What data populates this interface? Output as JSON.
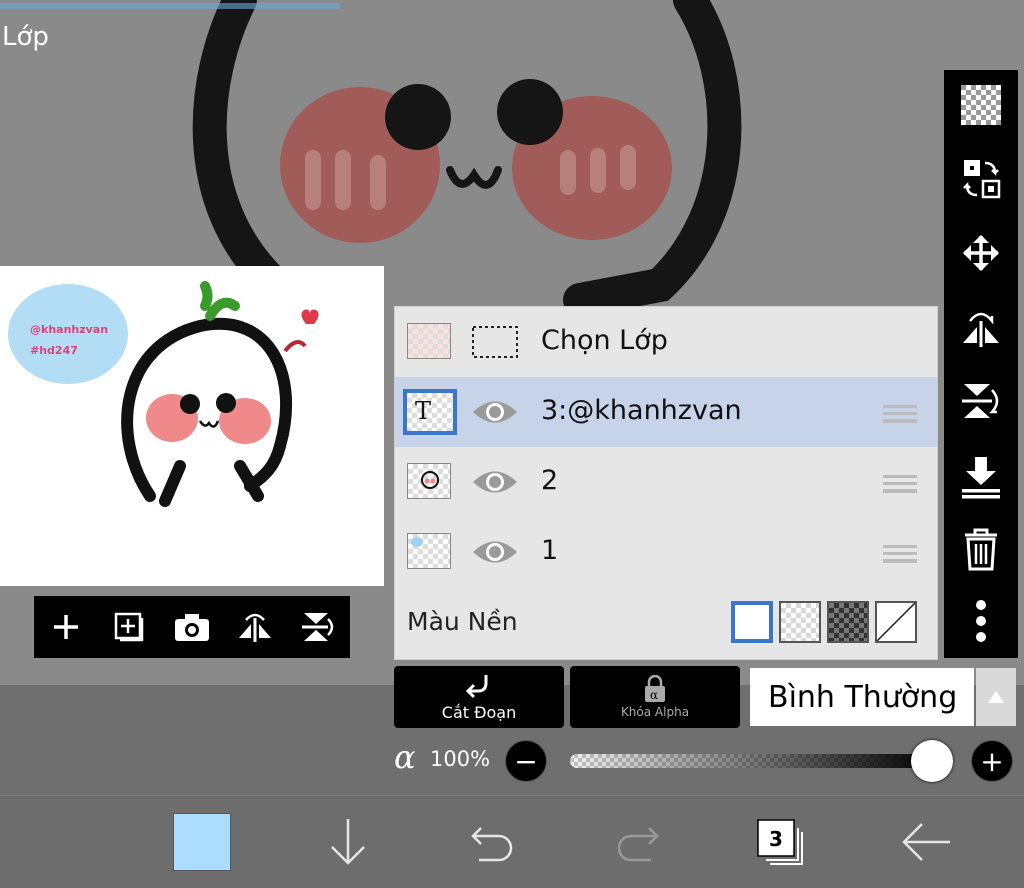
{
  "page": {
    "title": "Lớp"
  },
  "colors": {
    "selected_row": "#c7d3e8",
    "accent_blue": "#3c76c9",
    "foreground_color": "#acdcff"
  },
  "thumbnail": {
    "watermark_line1": "@khanhzvan",
    "watermark_line2": "#hd247"
  },
  "thumb_toolbar": [
    {
      "icon": "plus-icon"
    },
    {
      "icon": "add-layer-icon"
    },
    {
      "icon": "camera-icon"
    },
    {
      "icon": "flip-horizontal-icon"
    },
    {
      "icon": "flip-vertical-icon"
    }
  ],
  "right_toolbar": [
    {
      "icon": "transparency-icon"
    },
    {
      "icon": "swap-layer-icon"
    },
    {
      "icon": "move-icon"
    },
    {
      "icon": "flip-horizontal-icon"
    },
    {
      "icon": "flip-vertical-icon"
    },
    {
      "icon": "merge-down-icon"
    },
    {
      "icon": "trash-icon"
    },
    {
      "icon": "more-vertical-icon"
    }
  ],
  "layers": {
    "select_layer_label": "Chọn Lớp",
    "items": [
      {
        "label": "3:@khanhzvan",
        "thumb_text": "T",
        "selected": true
      },
      {
        "label": "2",
        "selected": false
      },
      {
        "label": "1",
        "selected": false
      }
    ],
    "background_label": "Màu Nền"
  },
  "controls": {
    "clipping_label": "Cắt Đoạn",
    "alpha_lock_label": "Khóa Alpha",
    "blend_mode": "Bình Thường",
    "alpha_symbol": "α",
    "opacity_text": "100%",
    "opacity_value": 1.0,
    "minus_label": "−",
    "plus_label": "+"
  },
  "bottom_nav": {
    "layer_count": "3"
  }
}
